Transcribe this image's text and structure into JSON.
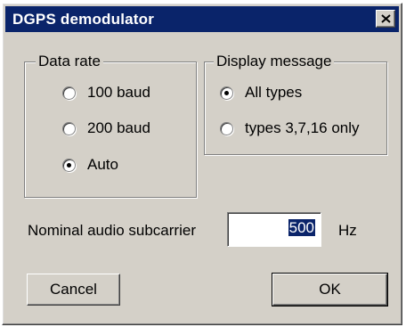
{
  "window": {
    "title": "DGPS demodulator",
    "close_glyph": "close-icon"
  },
  "data_rate": {
    "legend": "Data rate",
    "options": [
      {
        "label": "100 baud",
        "checked": false
      },
      {
        "label": "200 baud",
        "checked": false
      },
      {
        "label": "Auto",
        "checked": true
      }
    ]
  },
  "display_message": {
    "legend": "Display message",
    "options": [
      {
        "label": "All types",
        "checked": true
      },
      {
        "label": "types 3,7,16 only",
        "checked": false
      }
    ]
  },
  "subcarrier": {
    "label": "Nominal audio subcarrier",
    "value": "500",
    "unit": "Hz"
  },
  "buttons": {
    "cancel": "Cancel",
    "ok": "OK"
  },
  "colors": {
    "face": "#d4d0c8",
    "titlebar": "#0a246a",
    "selection": "#0a246a"
  }
}
